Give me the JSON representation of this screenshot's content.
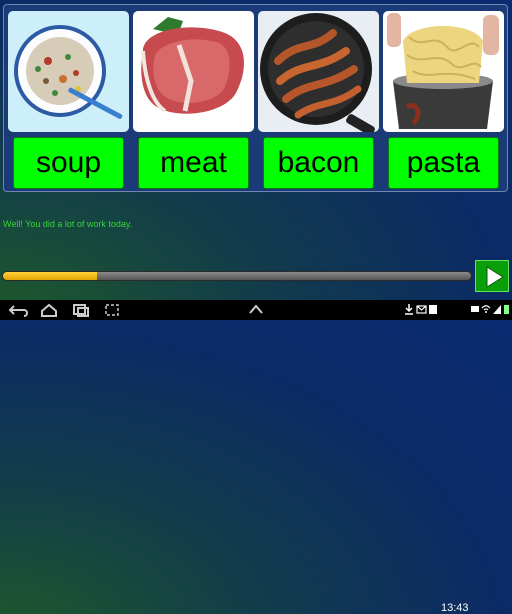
{
  "cards": [
    {
      "word": "soup",
      "image": "soup-bowl"
    },
    {
      "word": "meat",
      "image": "t-bone-steak"
    },
    {
      "word": "bacon",
      "image": "bacon-in-pan"
    },
    {
      "word": "pasta",
      "image": "spaghetti-pot"
    }
  ],
  "message": "Well! You did a lot of work today.",
  "progress": {
    "value": 0.2
  },
  "navigation": {
    "next_icon": "play-arrow-icon"
  },
  "system_bar": {
    "time": "13:43",
    "icons": [
      "back-icon",
      "home-icon",
      "recent-apps-icon",
      "screenshot-icon",
      "up-arrow-icon",
      "download-icon",
      "email-icon",
      "calendar-icon",
      "gmail-icon",
      "wifi-icon",
      "signal-icon",
      "battery-icon"
    ]
  },
  "colors": {
    "word_button": "#00ff00",
    "progress_fill": "#f2b600",
    "next_button": "#0a9f0a"
  }
}
